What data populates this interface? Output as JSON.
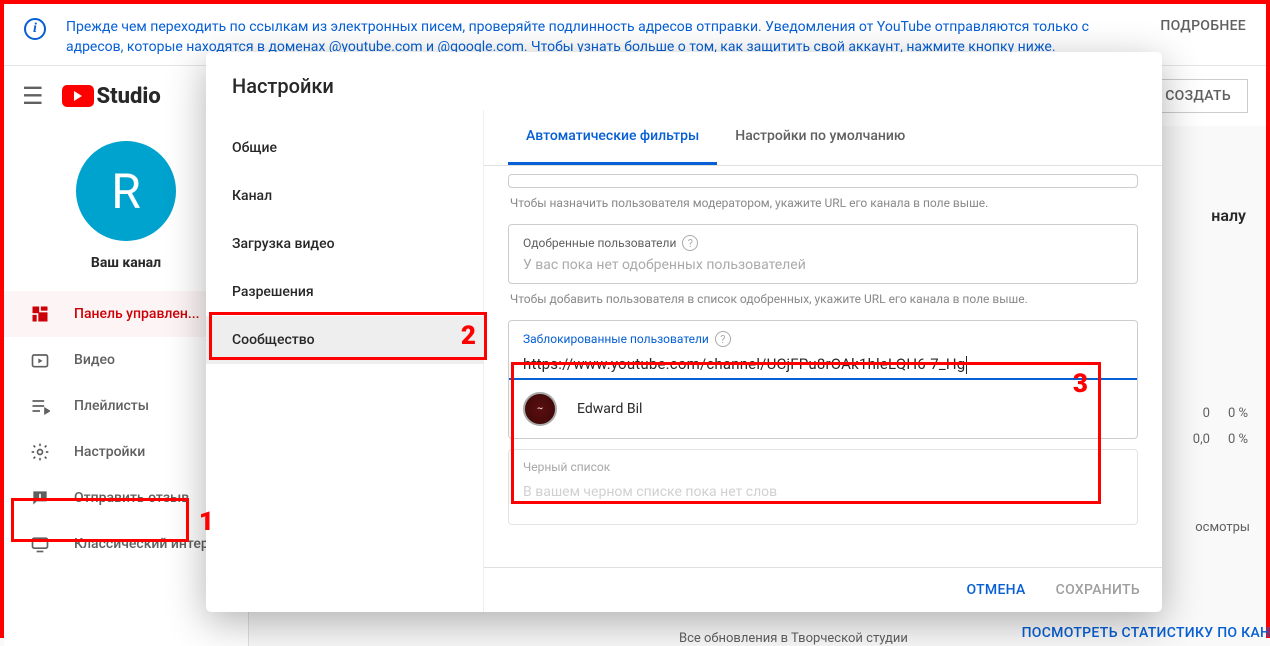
{
  "banner": {
    "text": "Прежде чем переходить по ссылкам из электронных писем, проверяйте подлинность адресов отправки. Уведомления от YouTube отправляются только с адресов, которые находятся в доменах @youtube.com и @google.com. Чтобы узнать больше о том, как защитить свой аккаунт, нажмите кнопку ниже.",
    "more": "ПОДРОБНЕЕ"
  },
  "header": {
    "logo_text": "Studio",
    "create": "СОЗДАТЬ"
  },
  "sidebar": {
    "avatar_letter": "R",
    "channel": "Ваш канал",
    "items": [
      "Панель управлен...",
      "Видео",
      "Плейлисты",
      "Настройки",
      "Отправить отзыв",
      "Классический интер..."
    ]
  },
  "content_peek": {
    "analytics_hint": "налу",
    "stat1": {
      "a": "0",
      "b": "0 %"
    },
    "stat2": {
      "a": "0,0",
      "b": "0 %"
    },
    "views_label": "осмотры",
    "stats_link": "ПОСМОТРЕТЬ СТАТИСТИКУ ПО КАНА",
    "news": "Все обновления в Творческой студии"
  },
  "dialog": {
    "title": "Настройки",
    "nav": [
      "Общие",
      "Канал",
      "Загрузка видео",
      "Разрешения",
      "Сообщество"
    ],
    "tabs": [
      "Автоматические фильтры",
      "Настройки по умолчанию"
    ],
    "moderator_help": "Чтобы назначить пользователя модератором, укажите URL его канала в поле выше.",
    "approved": {
      "label": "Одобренные пользователи",
      "placeholder": "У вас пока нет одобренных пользователей",
      "help": "Чтобы добавить пользователя в список одобренных, укажите URL его канала в поле выше."
    },
    "blocked": {
      "label": "Заблокированные пользователи",
      "value": "https://www.youtube.com/channel/UCjFPu8rOAk1hleLQH6-7_Hg",
      "suggest": "Edward Bil"
    },
    "blacklist": {
      "label": "Черный список",
      "placeholder": "В вашем черном списке пока нет слов"
    },
    "buttons": {
      "cancel": "ОТМЕНА",
      "save": "СОХРАНИТЬ"
    }
  },
  "annotations": {
    "one": "1",
    "two": "2",
    "three": "3"
  }
}
